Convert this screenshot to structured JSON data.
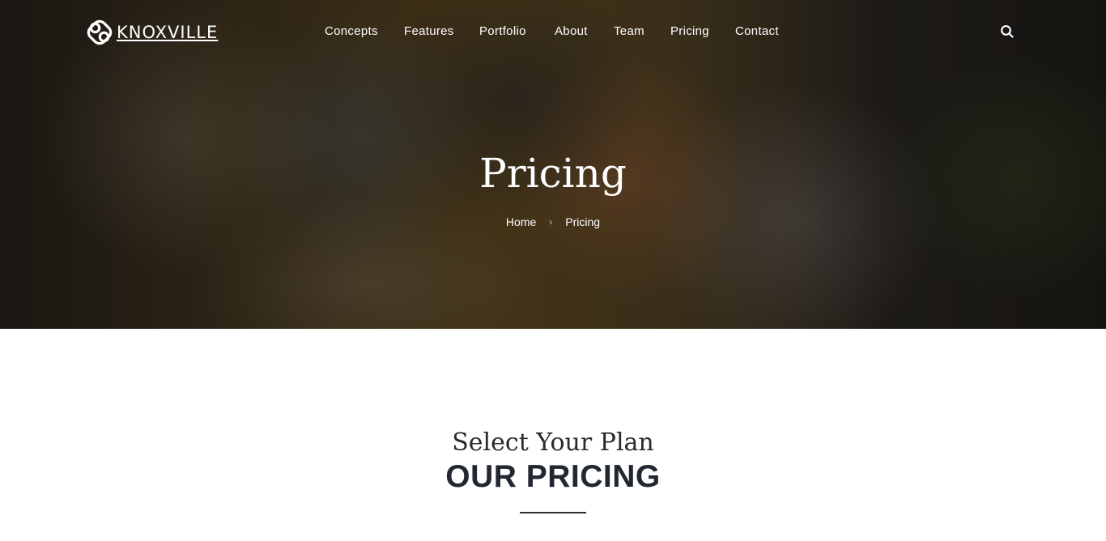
{
  "brand": {
    "name": "KNOXVILLE"
  },
  "nav": {
    "items": [
      {
        "label": "Concepts"
      },
      {
        "label": "Features"
      },
      {
        "label": "Portfolio"
      },
      {
        "label": "About"
      },
      {
        "label": "Team"
      },
      {
        "label": "Pricing"
      },
      {
        "label": "Contact"
      }
    ],
    "search_icon": "search-icon"
  },
  "hero": {
    "title": "Pricing",
    "breadcrumb": {
      "home": "Home",
      "separator": "›",
      "current": "Pricing"
    }
  },
  "section": {
    "subheading": "Select Your Plan",
    "heading": "OUR PRICING"
  },
  "colors": {
    "heading_text": "#222831",
    "divider": "#2a2f38",
    "hero_text": "#ffffff"
  }
}
